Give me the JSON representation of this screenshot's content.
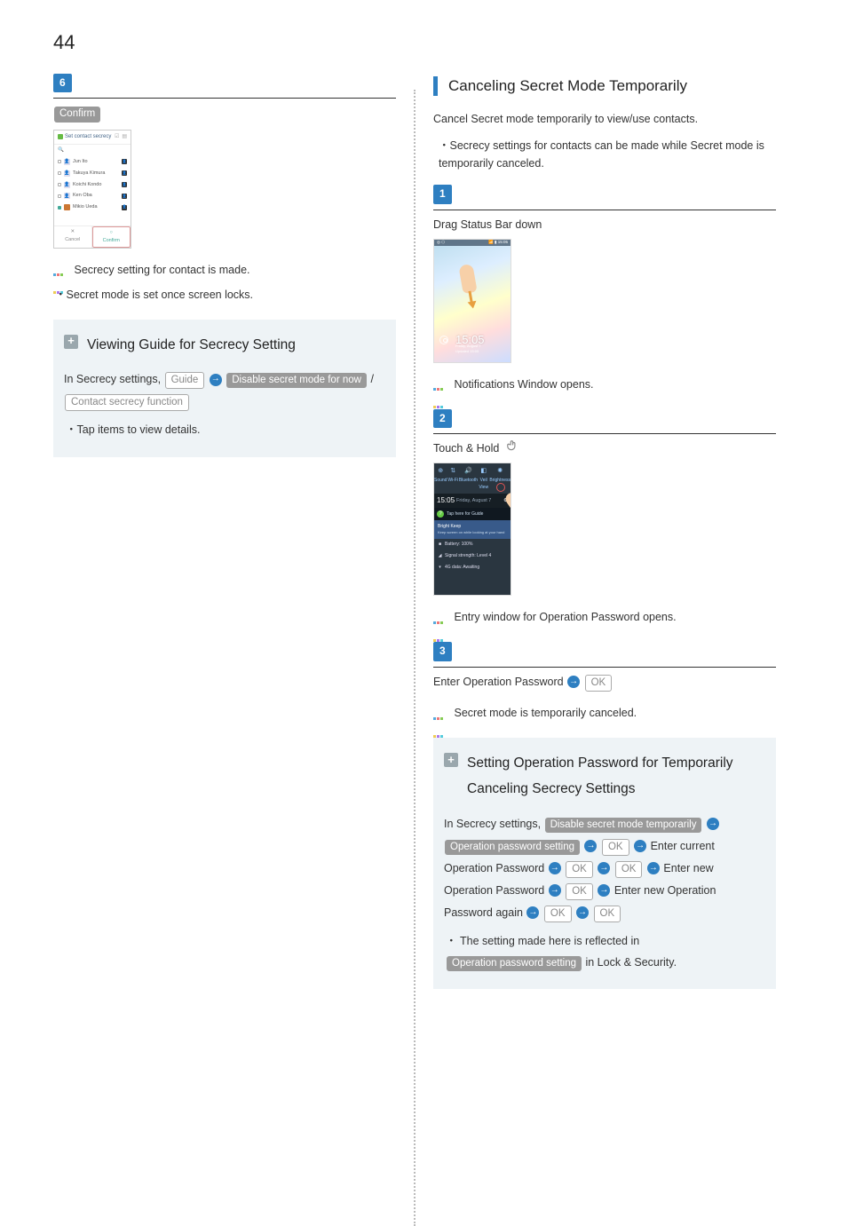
{
  "page_number": "44",
  "left": {
    "step6": {
      "num": "6",
      "confirm_btn": "Confirm",
      "phone": {
        "title": "Set contact secrecy",
        "search": "🔍",
        "contacts": [
          "Jun Ito",
          "Takuya Kimura",
          "Koichi Kondo",
          "Ken Oba",
          "Mikio Ueda"
        ],
        "cancel_char": "✕",
        "confirm_char": "○",
        "cancel_lbl": "Cancel",
        "confirm_lbl": "Confirm"
      },
      "result": "Secrecy setting for contact is made.",
      "note": "Secret mode is set once screen locks."
    },
    "tip": {
      "title": "Viewing Guide for Secrecy Setting",
      "lead": "In Secrecy settings, ",
      "btn_guide": "Guide",
      "btn_disable": "Disable secret mode for now",
      "slash": " / ",
      "btn_contact": "Contact secrecy function",
      "note": "Tap items to view details."
    }
  },
  "right": {
    "section_title": "Canceling Secret Mode Temporarily",
    "intro": "Cancel Secret mode temporarily to view/use contacts.",
    "intro_note": "Secrecy settings for contacts can be made while Secret mode is temporarily canceled.",
    "step1": {
      "num": "1",
      "instr": "Drag Status Bar down",
      "phone": {
        "sbar_left": "◎ ⬡",
        "sbar_right": "📶 ▮ 15:05",
        "clock": "15:05",
        "date_top": "Friday, August 7",
        "date_bottom": "Updated 15:05"
      },
      "result": "Notifications Window opens."
    },
    "step2": {
      "num": "2",
      "instr": "Touch & Hold ",
      "phone": {
        "q_items": [
          {
            "icon": "⊕",
            "lbl": "Sound"
          },
          {
            "icon": "⇅",
            "lbl": "Wi-Fi"
          },
          {
            "icon": "🔊",
            "lbl": "Bluetooth"
          },
          {
            "icon": "◧",
            "lbl": "Veil View"
          },
          {
            "icon": "✺",
            "lbl": "Brightness"
          }
        ],
        "time": "15:05",
        "time_sub": "Friday, August 7",
        "gear": "⚙",
        "guide": "Tap here for Guide",
        "card_title": "Bright Keep",
        "card_sub": "Keep screen on while looking at your hand",
        "rows": [
          {
            "icon": "■",
            "text": "Battery: 100%"
          },
          {
            "icon": "◢",
            "text": "Signal strength: Level 4"
          },
          {
            "icon": "▾",
            "text": "4G data: Awaiting"
          }
        ]
      },
      "result": "Entry window for Operation Password opens."
    },
    "step3": {
      "num": "3",
      "instr_text": "Enter Operation Password ",
      "ok": "OK",
      "result": "Secret mode is temporarily canceled."
    },
    "tip": {
      "title": "Setting Operation Password for Temporarily Canceling Secrecy Settings",
      "lead": "In Secrecy settings, ",
      "btn_disable_temp": "Disable secret mode temporarily",
      "btn_op_pw": "Operation password setting",
      "ok": "OK",
      "txt_enter_current": " Enter current Operation Password ",
      "txt_enter_new": " Enter new Operation Password ",
      "txt_enter_again": " Enter new Operation Password again ",
      "note_lead": "The setting made here is reflected in ",
      "btn_op_pw2": "Operation password setting",
      "note_tail": " in Lock & Security."
    }
  }
}
